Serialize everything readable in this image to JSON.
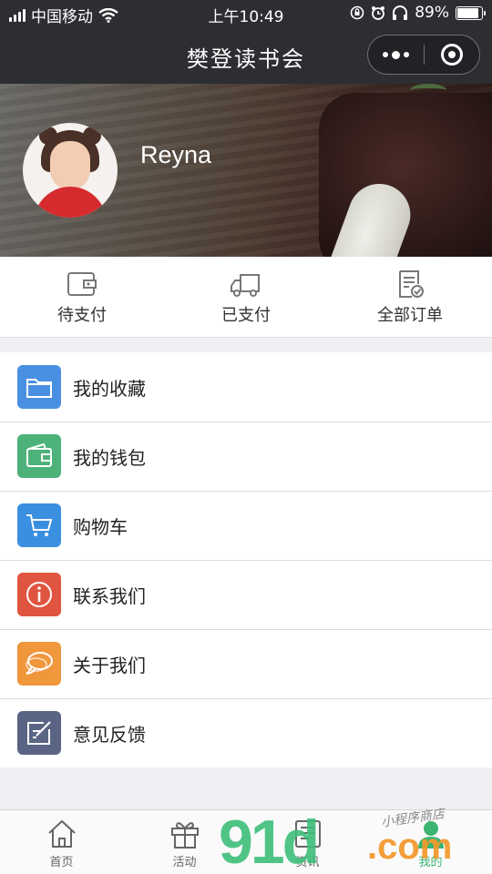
{
  "status_bar": {
    "carrier": "中国移动",
    "time": "上午10:49",
    "battery_percent": "89%",
    "battery_level": 0.89,
    "icons": [
      "signal-icon",
      "wifi-icon",
      "orientation-lock-icon",
      "alarm-icon",
      "headphones-icon",
      "battery-icon"
    ]
  },
  "navbar": {
    "title": "樊登读书会",
    "icons": [
      "more-dots-icon",
      "close-target-icon"
    ]
  },
  "profile": {
    "username": "Reyna"
  },
  "orders": [
    {
      "label": "待支付",
      "icon": "wallet-icon"
    },
    {
      "label": "已支付",
      "icon": "delivery-truck-icon"
    },
    {
      "label": "全部订单",
      "icon": "order-list-icon"
    }
  ],
  "menu": [
    {
      "label": "我的收藏",
      "icon": "folder-icon",
      "color": "#4a90e2"
    },
    {
      "label": "我的钱包",
      "icon": "wallet-icon",
      "color": "#4cb27a"
    },
    {
      "label": "购物车",
      "icon": "shopping-cart-icon",
      "color": "#3b8fe0"
    },
    {
      "label": "联系我们",
      "icon": "info-icon",
      "color": "#e0553f"
    },
    {
      "label": "关于我们",
      "icon": "chat-bubble-icon",
      "color": "#f0963b"
    },
    {
      "label": "意见反馈",
      "icon": "feedback-edit-icon",
      "color": "#5a6585"
    }
  ],
  "tabbar": [
    {
      "label": "首页",
      "icon": "home-icon",
      "active": false
    },
    {
      "label": "活动",
      "icon": "gift-icon",
      "active": false
    },
    {
      "label": "资讯",
      "icon": "news-icon",
      "active": false
    },
    {
      "label": "我的",
      "icon": "user-icon",
      "active": true
    }
  ],
  "watermark": {
    "number": "91",
    "letter": "d",
    "domain": ".com",
    "subtitle": "小程序商店"
  },
  "colors": {
    "navbar_bg": "#2c2e32",
    "page_bg": "#efeff4",
    "tab_active": "#3cb371"
  }
}
